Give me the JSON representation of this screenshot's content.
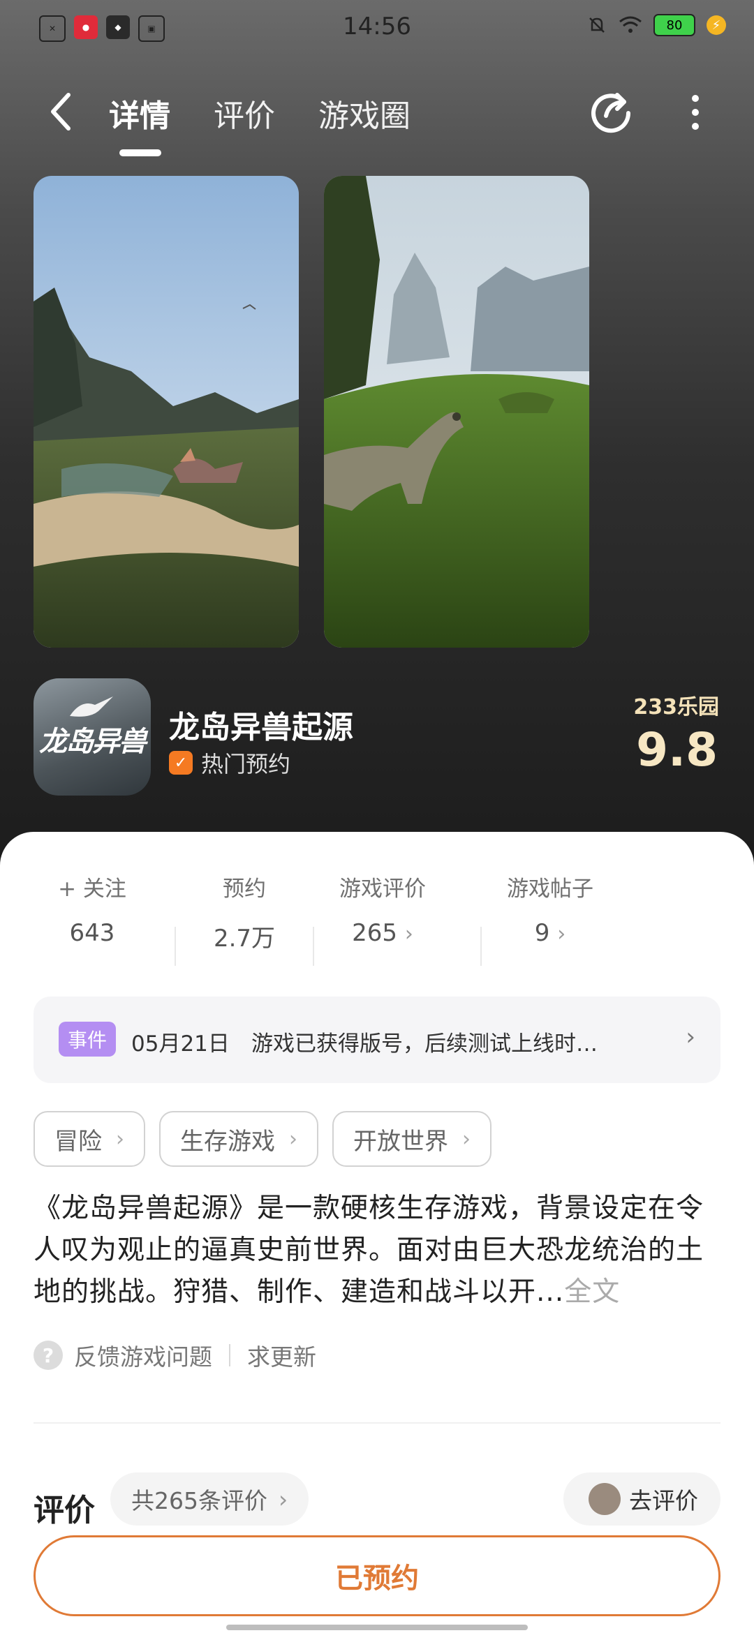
{
  "status_bar": {
    "time": "14:56",
    "left_icons": [
      "close-box-icon",
      "app-red-icon",
      "youxia-icon",
      "iqiyi-icon"
    ],
    "battery": "80"
  },
  "nav": {
    "tabs": [
      "详情",
      "评价",
      "游戏圈"
    ],
    "active_tab": "详情"
  },
  "game": {
    "name": "龙岛异兽起源",
    "badge": "热门预约",
    "icon_text": "龙岛异兽",
    "platform": "233乐园",
    "score": "9.8"
  },
  "stats": [
    {
      "label": "+ 关注",
      "value": "643"
    },
    {
      "label": "预约",
      "value": "2.7万"
    },
    {
      "label": "游戏评价",
      "value": "265"
    },
    {
      "label": "游戏帖子",
      "value": "9"
    }
  ],
  "event": {
    "tag": "事件",
    "date": "05月21日",
    "text": "游戏已获得版号，后续测试上线时…"
  },
  "tags": [
    "冒险",
    "生存游戏",
    "开放世界"
  ],
  "description": {
    "text": "《龙岛异兽起源》是一款硬核生存游戏，背景设定在令人叹为观止的逼真史前世界。面对由巨大恐龙统治的土地的挑战。狩猎、制作、建造和战斗以开...",
    "more": "全文"
  },
  "feedback": {
    "report": "反馈游戏问题",
    "request": "求更新"
  },
  "reviews": {
    "title": "评价",
    "count": "共265条评价",
    "go": "去评价"
  },
  "bottom": {
    "action": "已预约"
  },
  "colors": {
    "accent": "#e07a36",
    "event_tag": "#b48ef2",
    "score": "#f7e7c3"
  }
}
